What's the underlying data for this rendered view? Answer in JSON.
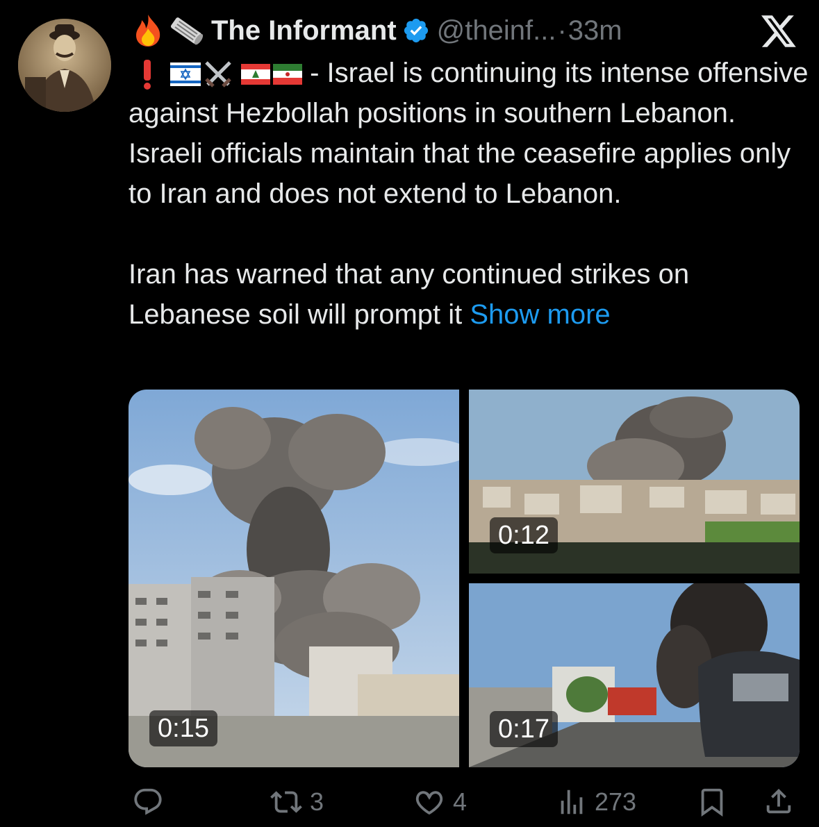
{
  "author": {
    "name": "The Informant",
    "handle": "@theinf...",
    "dot": "·",
    "time": "33m",
    "lead_emoji": [
      "fire-emoji",
      "newspaper-roll-emoji"
    ]
  },
  "tweet": {
    "first_line": " - Israel is continuing its intense offensive against Hezbollah positions in southern Lebanon. Israeli officials maintain that the ceasefire applies only to Iran and does not extend to Lebanon.",
    "second_paragraph": "Iran has warned that any continued strikes on Lebanese soil will prompt it ",
    "show_more": "Show more"
  },
  "media": [
    {
      "duration": "0:15",
      "description_icon": "explosion-city-video"
    },
    {
      "duration": "0:12",
      "description_icon": "smoke-over-town-video"
    },
    {
      "duration": "0:17",
      "description_icon": "street-smoke-video"
    }
  ],
  "actions": {
    "reply_count": "",
    "retweet_count": "3",
    "like_count": "4",
    "views_count": "273"
  },
  "colors": {
    "background": "#000000",
    "text": "#e7e9ea",
    "secondary": "#71767b",
    "link": "#1d9bf0",
    "verified": "#1d9bf0"
  }
}
